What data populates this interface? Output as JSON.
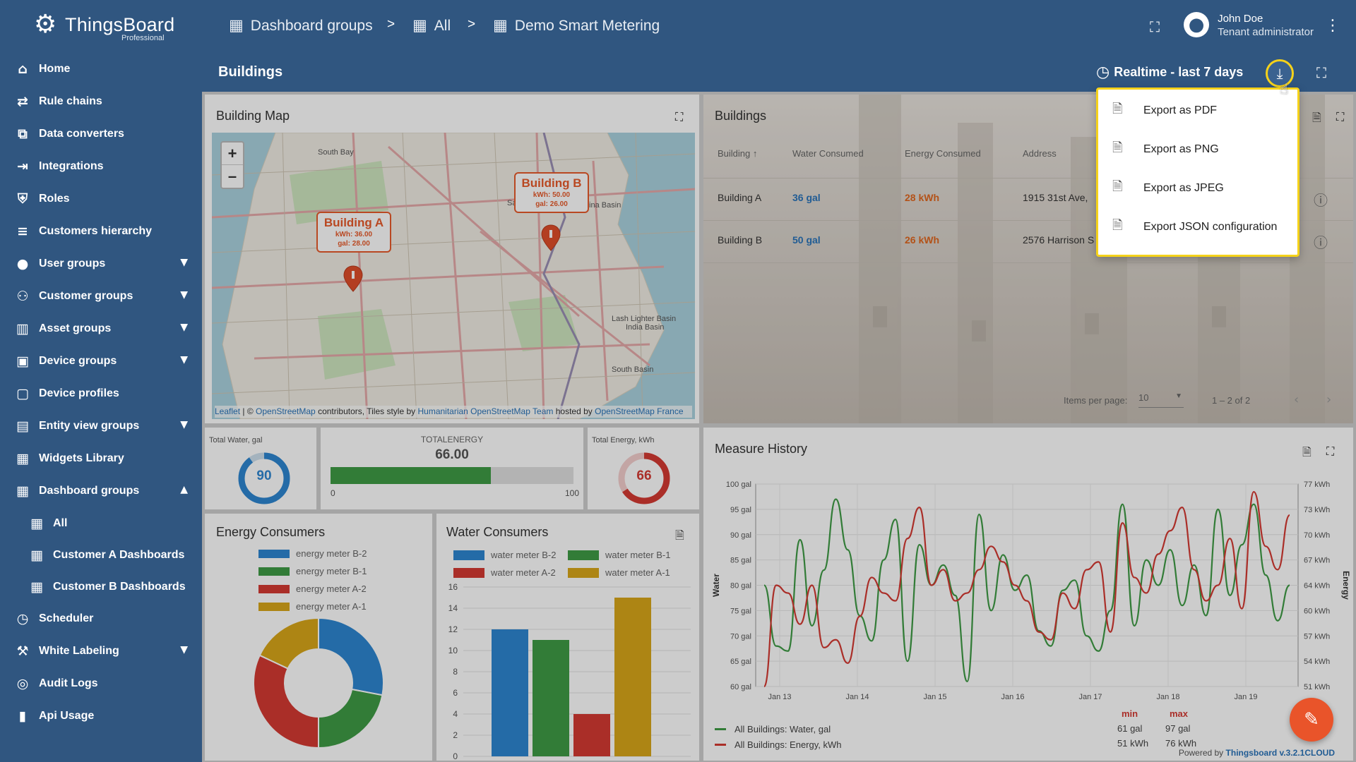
{
  "app": {
    "logo_name": "ThingsBoard",
    "edition": "Professional"
  },
  "sidebar": {
    "items": [
      {
        "label": "Home",
        "icon": "home-icon"
      },
      {
        "label": "Rule chains",
        "icon": "rule-chain-icon"
      },
      {
        "label": "Data converters",
        "icon": "converter-icon"
      },
      {
        "label": "Integrations",
        "icon": "integration-icon"
      },
      {
        "label": "Roles",
        "icon": "shield-icon"
      },
      {
        "label": "Customers hierarchy",
        "icon": "hierarchy-icon"
      },
      {
        "label": "User groups",
        "icon": "user-icon",
        "expandable": true
      },
      {
        "label": "Customer groups",
        "icon": "people-icon",
        "expandable": true
      },
      {
        "label": "Asset groups",
        "icon": "building-icon",
        "expandable": true
      },
      {
        "label": "Device groups",
        "icon": "devices-icon",
        "expandable": true
      },
      {
        "label": "Device profiles",
        "icon": "device-profile-icon"
      },
      {
        "label": "Entity view groups",
        "icon": "entity-view-icon",
        "expandable": true
      },
      {
        "label": "Widgets Library",
        "icon": "widgets-icon"
      },
      {
        "label": "Dashboard groups",
        "icon": "dashboard-icon",
        "expanded": true
      },
      {
        "label": "All",
        "icon": "dashboard-icon",
        "sub": true
      },
      {
        "label": "Customer A Dashboards",
        "icon": "dashboard-icon",
        "sub": true
      },
      {
        "label": "Customer B Dashboards",
        "icon": "dashboard-icon",
        "sub": true
      },
      {
        "label": "Scheduler",
        "icon": "clock-icon"
      },
      {
        "label": "White Labeling",
        "icon": "paint-icon",
        "expandable": true
      },
      {
        "label": "Audit Logs",
        "icon": "audit-icon"
      },
      {
        "label": "Api Usage",
        "icon": "chart-icon"
      }
    ]
  },
  "header": {
    "breadcrumbs": [
      "Dashboard groups",
      "All",
      "Demo Smart Metering"
    ],
    "separator": ">",
    "user_name": "John Doe",
    "user_role": "Tenant administrator"
  },
  "dashboard": {
    "title": "Buildings",
    "timewindow": "Realtime - last 7 days"
  },
  "export_menu": {
    "items": [
      "Export as PDF",
      "Export as PNG",
      "Export as JPEG",
      "Export JSON configuration"
    ]
  },
  "map_widget": {
    "title": "Building Map",
    "zoom_in": "+",
    "zoom_out": "–",
    "labels": [
      "South Bay",
      "China Basin",
      "Lash Lighter Basin",
      "India Basin",
      "South Basin",
      "Sa"
    ],
    "markers": [
      {
        "name": "Building A",
        "kwh": "kWh: 36.00",
        "gal": "gal: 28.00"
      },
      {
        "name": "Building B",
        "kwh": "kWh: 50.00",
        "gal": "gal: 26.00"
      }
    ],
    "attribution": {
      "leaflet": "Leaflet",
      "osm_prefix": "| ©",
      "osm": "OpenStreetMap",
      "mid": "contributors, Tiles style by",
      "hot": "Humanitarian OpenStreetMap Team",
      "hosted": "hosted by",
      "osm_fr": "OpenStreetMap France"
    }
  },
  "buildings_table": {
    "title": "Buildings",
    "columns": [
      "Building",
      "Water Consumed",
      "Energy Consumed",
      "Address"
    ],
    "sort_icon": "↑",
    "rows": [
      {
        "building": "Building A",
        "water": "36 gal",
        "energy": "28 kWh",
        "address": "1915 31st Ave,"
      },
      {
        "building": "Building B",
        "water": "50 gal",
        "energy": "26 kWh",
        "address": "2576 Harrison S"
      }
    ],
    "items_per_page_label": "Items per page:",
    "items_per_page": "10",
    "range": "1 – 2 of 2"
  },
  "total_water": {
    "title": "Total Water, gal",
    "value": "90",
    "fraction": 0.9
  },
  "total_energy_bar": {
    "title": "TOTALENERGY",
    "value": "66.00",
    "min": "0",
    "max": "100",
    "fraction": 0.66
  },
  "total_energy_gauge": {
    "title": "Total Energy, kWh",
    "value": "66",
    "fraction": 0.66
  },
  "energy_consumers": {
    "title": "Energy Consumers",
    "chart_data": {
      "type": "pie",
      "labels": [
        "energy meter B-2",
        "energy meter B-1",
        "energy meter A-2",
        "energy meter A-1"
      ],
      "values": [
        28,
        22,
        32,
        18
      ],
      "colors": [
        "#2e86d1",
        "#3f9b45",
        "#d53a33",
        "#d9a71a"
      ]
    }
  },
  "water_consumers": {
    "title": "Water Consumers",
    "chart_data": {
      "type": "bar",
      "series": [
        {
          "name": "water meter B-2",
          "values": [
            12
          ],
          "color": "#2e86d1"
        },
        {
          "name": "water meter B-1",
          "values": [
            11
          ],
          "color": "#3f9b45"
        },
        {
          "name": "water meter A-2",
          "values": [
            4
          ],
          "color": "#d53a33"
        },
        {
          "name": "water meter A-1",
          "values": [
            15
          ],
          "color": "#d9a71a"
        }
      ],
      "ylim": [
        0,
        16
      ],
      "yticks": [
        "16",
        "14",
        "12",
        "10",
        "8",
        "6",
        "4",
        "2",
        "0"
      ]
    }
  },
  "measure_history": {
    "title": "Measure History",
    "chart_data": {
      "type": "line",
      "ylabel_left": "Water",
      "ylabel_right": "Energy",
      "left_ticks": [
        "100 gal",
        "95 gal",
        "90 gal",
        "85 gal",
        "80 gal",
        "75 gal",
        "70 gal",
        "65 gal",
        "60 gal"
      ],
      "right_ticks": [
        "77 kWh",
        "73 kWh",
        "70 kWh",
        "67 kWh",
        "64 kWh",
        "60 kWh",
        "57 kWh",
        "54 kWh",
        "51 kWh"
      ],
      "x_ticks": [
        "Jan 13",
        "Jan 14",
        "Jan 15",
        "Jan 16",
        "Jan 17",
        "Jan 18",
        "Jan 19"
      ],
      "series": [
        {
          "name": "All Buildings: Water, gal",
          "color": "#3f9b45",
          "min": "61 gal",
          "max": "97 gal",
          "values": [
            80,
            68,
            67,
            89,
            72,
            83,
            97,
            87,
            74,
            69,
            85,
            93,
            65,
            88,
            80,
            84,
            78,
            61,
            94,
            75,
            86,
            79,
            82,
            71,
            68,
            79,
            81,
            70,
            67,
            75,
            96,
            72,
            85,
            80,
            87,
            76,
            84,
            74,
            95,
            78,
            88,
            96,
            82,
            73,
            80
          ]
        },
        {
          "name": "All Buildings: Energy, kWh",
          "color": "#d53a33",
          "min": "51 kWh",
          "max": "76 kWh",
          "values": [
            51,
            64,
            63,
            59,
            64,
            56,
            57,
            54,
            60,
            65,
            63,
            62,
            70,
            74,
            64,
            66,
            62,
            63,
            66,
            69,
            67,
            64,
            62,
            58,
            57,
            63,
            61,
            66,
            67,
            58,
            72,
            65,
            63,
            68,
            71,
            74,
            66,
            62,
            64,
            70,
            61,
            76,
            69,
            66,
            73
          ]
        }
      ],
      "min_label": "min",
      "max_label": "max"
    }
  },
  "footer": {
    "powered_by": "Powered by",
    "version": "Thingsboard v.3.2.1CLOUD"
  }
}
